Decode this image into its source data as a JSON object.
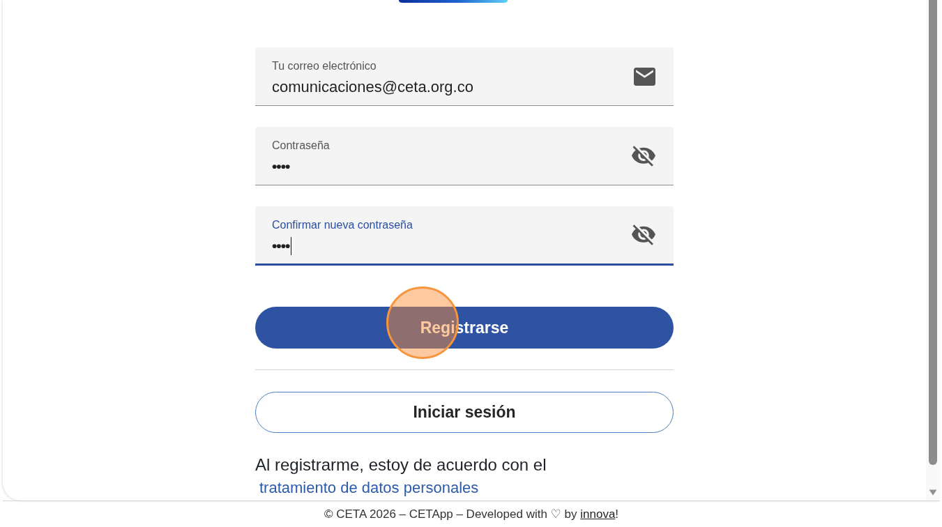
{
  "fields": [
    {
      "kind": "email",
      "label": "Tu correo electrónico",
      "value": "comunicaciones@ceta.org.co",
      "focused": false
    },
    {
      "kind": "password",
      "label": "Contraseña",
      "value": "••••",
      "focused": false,
      "visible": false
    },
    {
      "kind": "password",
      "label": "Confirmar nueva contraseña",
      "value": "••••",
      "focused": true,
      "visible": false
    }
  ],
  "register_button": {
    "label": "Registrarse",
    "clicked": true
  },
  "login_button": {
    "label": "Iniciar sesión"
  },
  "consent": {
    "text": "Al registrarme, estoy de acuerdo con el",
    "link": "tratamiento de datos personales"
  },
  "footer": {
    "text": "© CETA 2026 – CETApp – Developed with ♡ by",
    "link": "innova",
    "end": "!"
  }
}
